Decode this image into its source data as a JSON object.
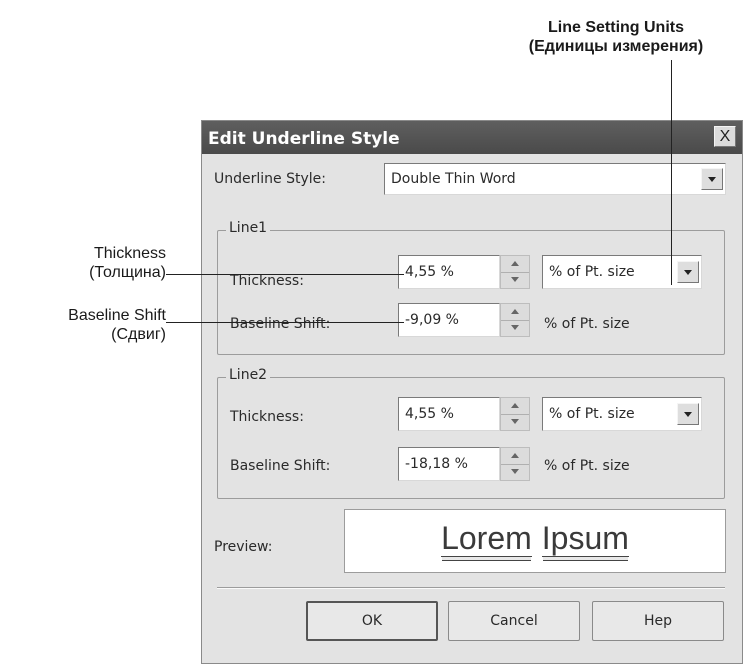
{
  "callouts": {
    "units_line1": "Line Setting Units",
    "units_line2": "(Единицы измерения)",
    "thickness_line1": "Thickness",
    "thickness_line2": "(Толщина)",
    "shift_line1": "Baseline Shift",
    "shift_line2": "(Сдвиг)"
  },
  "dialog": {
    "title": "Edit Underline Style",
    "close_glyph": "X",
    "underline_style": {
      "label": "Underline Style:",
      "value": "Double Thin Word"
    },
    "line1": {
      "legend": "Line1",
      "thickness_label": "Thickness:",
      "thickness_value": "4,55 %",
      "thickness_units": "% of Pt. size",
      "shift_label": "Baseline Shift:",
      "shift_value": "-9,09 %",
      "shift_units": "% of Pt. size"
    },
    "line2": {
      "legend": "Line2",
      "thickness_label": "Thickness:",
      "thickness_value": "4,55 %",
      "thickness_units": "% of Pt. size",
      "shift_label": "Baseline Shift:",
      "shift_value": "-18,18 %",
      "shift_units": "% of Pt. size"
    },
    "preview": {
      "label": "Preview:",
      "word1": "Lorem",
      "word2": "Ipsum"
    },
    "buttons": {
      "ok": "OK",
      "cancel": "Cancel",
      "help": "Hep"
    }
  },
  "icons": {
    "dropdown": "chevron-down-icon",
    "spin_up": "spin-up-icon",
    "spin_down": "spin-down-icon",
    "close": "close-icon"
  }
}
